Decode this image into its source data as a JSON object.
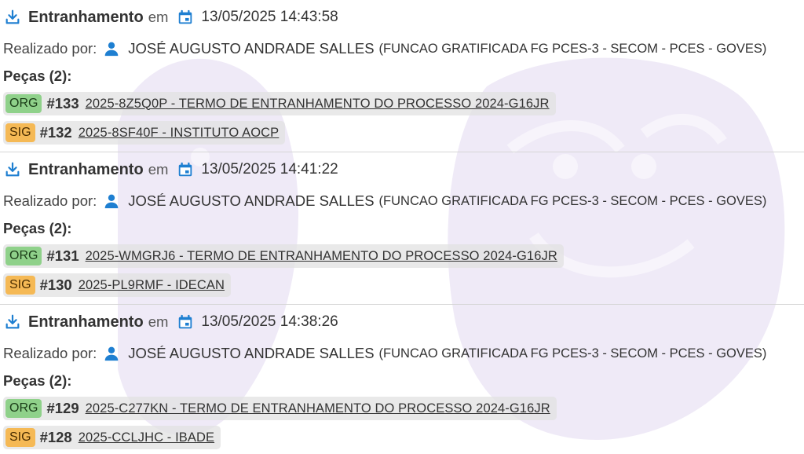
{
  "colors": {
    "accent": "#1e7fd1",
    "org_badge": "#8fd18a",
    "sig_badge": "#f5b955",
    "watermark": "#efeaf7"
  },
  "events": [
    {
      "action": "Entranhamento",
      "em": "em",
      "datetime": "13/05/2025 14:43:58",
      "realizado_label": "Realizado por:",
      "person": "JOSÉ AUGUSTO ANDRADE SALLES",
      "role": "(FUNCAO GRATIFICADA FG PCES-3 - SECOM - PCES - GOVES)",
      "pecas_label": "Peças (2):",
      "pieces": [
        {
          "badge": "ORG",
          "number": "#133",
          "link": "2025-8Z5Q0P - TERMO DE ENTRANHAMENTO DO PROCESSO 2024-G16JR"
        },
        {
          "badge": "SIG",
          "number": "#132",
          "link": "2025-8SF40F - INSTITUTO AOCP"
        }
      ]
    },
    {
      "action": "Entranhamento",
      "em": "em",
      "datetime": "13/05/2025 14:41:22",
      "realizado_label": "Realizado por:",
      "person": "JOSÉ AUGUSTO ANDRADE SALLES",
      "role": "(FUNCAO GRATIFICADA FG PCES-3 - SECOM - PCES - GOVES)",
      "pecas_label": "Peças (2):",
      "pieces": [
        {
          "badge": "ORG",
          "number": "#131",
          "link": "2025-WMGRJ6 - TERMO DE ENTRANHAMENTO DO PROCESSO 2024-G16JR"
        },
        {
          "badge": "SIG",
          "number": "#130",
          "link": "2025-PL9RMF - IDECAN"
        }
      ]
    },
    {
      "action": "Entranhamento",
      "em": "em",
      "datetime": "13/05/2025 14:38:26",
      "realizado_label": "Realizado por:",
      "person": "JOSÉ AUGUSTO ANDRADE SALLES",
      "role": "(FUNCAO GRATIFICADA FG PCES-3 - SECOM - PCES - GOVES)",
      "pecas_label": "Peças (2):",
      "pieces": [
        {
          "badge": "ORG",
          "number": "#129",
          "link": "2025-C277KN - TERMO DE ENTRANHAMENTO DO PROCESSO 2024-G16JR"
        },
        {
          "badge": "SIG",
          "number": "#128",
          "link": "2025-CCLJHC - IBADE"
        }
      ]
    }
  ]
}
